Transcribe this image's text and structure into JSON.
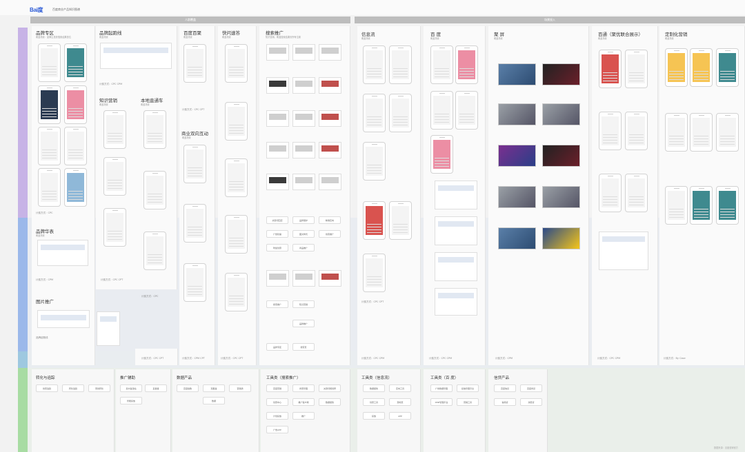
{
  "header": {
    "logo_text": "Bai度",
    "title": "百度商业产品知识图谱"
  },
  "banners": {
    "left": "人群覆盖",
    "right": "场景接入"
  },
  "colors": {
    "row1": "#c7b3e6",
    "row2": "#9bb8ea",
    "row3": "#9ec8e0",
    "row4": "#a8dca3",
    "banner": "#bdbdbd"
  },
  "sections": {
    "brand_zone": {
      "title": "品牌专区",
      "sub": "覆盖场景：品牌主投放搜索结果首位",
      "note": "品牌专区"
    },
    "brand_starlink": {
      "title": "品牌起跑线",
      "sub": "覆盖场景",
      "note": "品牌起跑线"
    },
    "image_ad": {
      "title": "图片推广",
      "note": "品牌起跑线"
    },
    "brand_pictorial": {
      "title": "品牌华表",
      "sub": "覆盖场景"
    },
    "precise_marketing": {
      "title": "知识营销",
      "sub": "覆盖场景"
    },
    "local_express": {
      "title": "本地直通车",
      "sub": "覆盖场景"
    },
    "baidu_app": {
      "title": "百度百聚",
      "sub": "覆盖场景"
    },
    "quick_inquiry": {
      "title": "快问速答",
      "sub": "覆盖场景"
    },
    "search_promo": {
      "title": "搜索推广",
      "sub": "知识营销，覆盖搜索结果页所有位置"
    },
    "two_way": {
      "title": "商业双向互动",
      "sub": "覆盖场景"
    },
    "feed": {
      "title": "信息流",
      "sub": "覆盖场景"
    },
    "baidu_union": {
      "title": "百 度",
      "sub": "覆盖场景"
    },
    "poly": {
      "title": "聚 屏",
      "sub": "覆盖场景"
    },
    "baitong": {
      "title": "百通（聚优联合展示）",
      "sub": "覆盖场景"
    },
    "custom": {
      "title": "定制化营销",
      "sub": "覆盖场景"
    }
  },
  "footnotes": {
    "a": "计费方式：CPC CPT",
    "b": "计费方式：CPM CPT",
    "c": "计费方式：CPC",
    "d": "计费方式：CPM",
    "e": "计费方式：CPC CPM",
    "f": "计费方式：By Case"
  },
  "search_pills": [
    "关键词匹配",
    "品牌保护",
    "精准定向",
    "广告轮播",
    "图文样式",
    "线索推广",
    "附加创意",
    "商品推广",
    "App推广",
    "落地页"
  ],
  "search_pills_2": [
    "搜索推广",
    "知识营销",
    "品牌推广",
    "品牌专区",
    "搜索页"
  ],
  "bottom": {
    "convert": {
      "title": "转化与追踪",
      "pills": [
        "线索追踪",
        "转化追踪",
        "离线转化"
      ]
    },
    "promo_assist": {
      "title": "推广辅助",
      "pills": [
        "基木鱼建站",
        "爱番番",
        "智能投放"
      ]
    },
    "data_product": {
      "title": "数据产品",
      "pills": [
        "百度指数",
        "观星盘",
        "营销通",
        "数据"
      ]
    },
    "tools_search": {
      "title": "工具类（搜索推广）",
      "pills": [
        "百度营销",
        "商家管理",
        "关键词规划师",
        "创意中心",
        "推广客户端",
        "数据报告",
        "计划投放",
        "推广",
        "广告APP"
      ]
    },
    "tools_feed": {
      "title": "工具类（信息流）",
      "pills": [
        "数据报告",
        "定向工具",
        "创意工具",
        "落地页",
        "投放",
        "APP"
      ]
    },
    "tools_baidu": {
      "title": "工具类（百 度）",
      "pills": [
        "广告数据管理",
        "投放管理平台",
        "DMP管理平台",
        "营销工具"
      ]
    },
    "ecosystem": {
      "title": "信贷产品",
      "pills": [
        "百度信贷",
        "百度商贷",
        "信用贷",
        "消费贷"
      ]
    }
  },
  "watermark": "数据来源：百度营销官方"
}
